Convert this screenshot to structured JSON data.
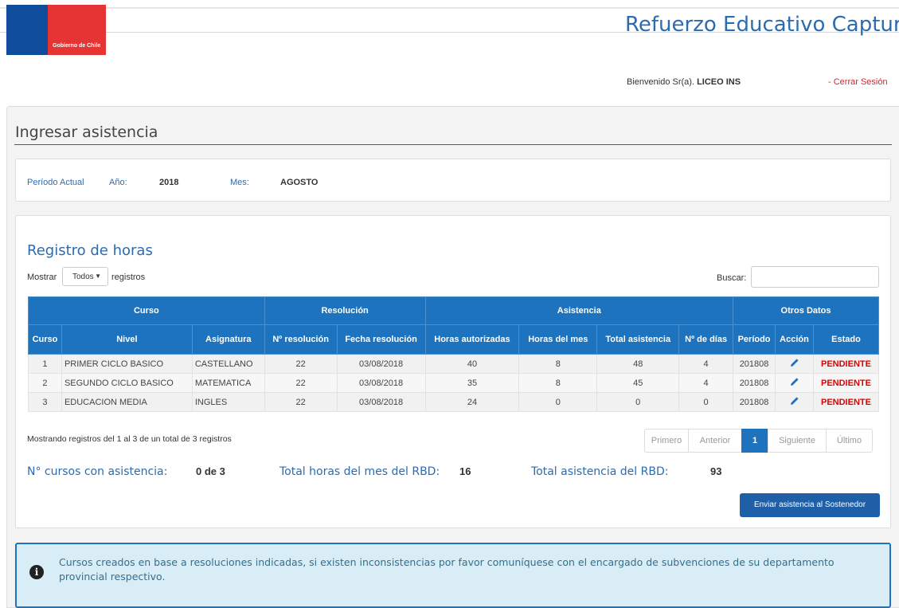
{
  "header": {
    "logo_text": "Gobierno de Chile",
    "app_title": "Refuerzo Educativo Captura",
    "welcome_prefix": "Bienvenido Sr(a).",
    "user_name": "LICEO INS",
    "logout_label": "- Cerrar Sesión"
  },
  "page": {
    "title": "Ingresar asistencia"
  },
  "period": {
    "label": "Período Actual",
    "year_label": "Año:",
    "year_value": "2018",
    "month_label": "Mes:",
    "month_value": "AGOSTO"
  },
  "registro": {
    "title": "Registro de horas",
    "show_label": "Mostrar",
    "show_value": "Todos",
    "show_suffix": "registros",
    "search_label": "Buscar:",
    "search_value": ""
  },
  "table": {
    "group_headers": [
      "Curso",
      "Resolución",
      "Asistencia",
      "Otros Datos"
    ],
    "columns": [
      "Curso",
      "Nivel",
      "Asignatura",
      "Nº resolución",
      "Fecha resolución",
      "Horas autorizadas",
      "Horas del mes",
      "Total asistencia",
      "Nº de días",
      "Período",
      "Acción",
      "Estado"
    ],
    "rows": [
      {
        "curso": "1",
        "nivel": "PRIMER CICLO BASICO",
        "asignatura": "CASTELLANO",
        "resolucion": "22",
        "fecha": "03/08/2018",
        "horas_aut": "40",
        "horas_mes": "8",
        "total_asist": "48",
        "dias": "4",
        "periodo": "201808",
        "estado": "PENDIENTE"
      },
      {
        "curso": "2",
        "nivel": "SEGUNDO CICLO BASICO",
        "asignatura": "MATEMATICA",
        "resolucion": "22",
        "fecha": "03/08/2018",
        "horas_aut": "35",
        "horas_mes": "8",
        "total_asist": "45",
        "dias": "4",
        "periodo": "201808",
        "estado": "PENDIENTE"
      },
      {
        "curso": "3",
        "nivel": "EDUCACION MEDIA",
        "asignatura": "INGLES",
        "resolucion": "22",
        "fecha": "03/08/2018",
        "horas_aut": "24",
        "horas_mes": "0",
        "total_asist": "0",
        "dias": "0",
        "periodo": "201808",
        "estado": "PENDIENTE"
      }
    ]
  },
  "info_text": "Mostrando registros del 1 al 3 de un total de 3 registros",
  "pager": {
    "first": "Primero",
    "prev": "Anterior",
    "current": "1",
    "next": "Siguiente",
    "last": "Último"
  },
  "totals": {
    "cursos_label": "N° cursos con asistencia:",
    "cursos_value": "0 de 3",
    "horas_label": "Total horas del mes del RBD:",
    "horas_value": "16",
    "asist_label": "Total asistencia del RBD:",
    "asist_value": "93"
  },
  "send_button": "Enviar asistencia al Sostenedor",
  "alert": {
    "icon": "info-icon",
    "text": "Cursos creados en base a resoluciones indicadas, si existen inconsistencias por favor comuníquese con el encargado de subvenciones de su departamento provincial respectivo."
  },
  "colors": {
    "primary": "#1e73be",
    "brand_blue": "#0f4c9c",
    "brand_red": "#e63434",
    "status_pending": "#e00000"
  }
}
